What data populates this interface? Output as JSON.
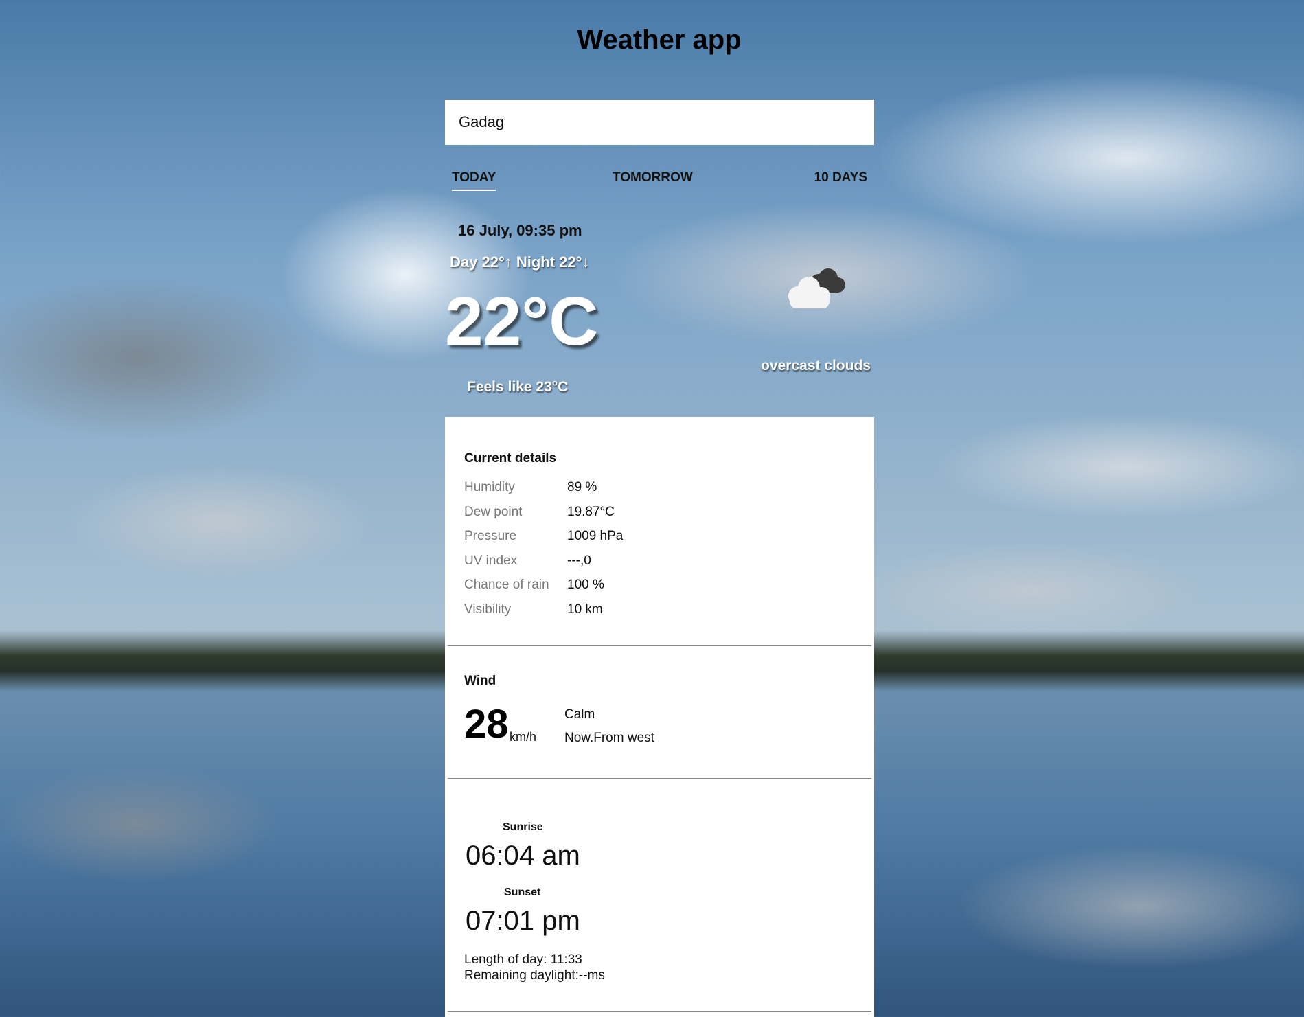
{
  "header": {
    "title": "Weather app"
  },
  "search": {
    "value": "Gadag",
    "placeholder": ""
  },
  "tabs": [
    {
      "label": "TODAY",
      "active": true
    },
    {
      "label": "TOMORROW",
      "active": false
    },
    {
      "label": "10 DAYS",
      "active": false
    }
  ],
  "current": {
    "date": "16 July, 09:35 pm",
    "day_night": "Day 22°↑ Night 22°↓",
    "temperature": "22°C",
    "feels_like": "Feels like 23°C",
    "condition": "overcast clouds",
    "icon": "overcast-cloud-icon"
  },
  "details": {
    "title": "Current details",
    "rows": [
      {
        "label": "Humidity",
        "value": "89 %"
      },
      {
        "label": "Dew point",
        "value": "19.87°C"
      },
      {
        "label": "Pressure",
        "value": "1009 hPa"
      },
      {
        "label": "UV index",
        "value": "---,0"
      },
      {
        "label": "Chance of rain",
        "value": "100 %"
      },
      {
        "label": "Visibility",
        "value": "10 km"
      }
    ]
  },
  "wind": {
    "title": "Wind",
    "speed": "28",
    "unit": "km/h",
    "description": "Calm",
    "direction": "Now.From west"
  },
  "sun": {
    "sunrise_label": "Sunrise",
    "sunrise": "06:04 am",
    "sunset_label": "Sunset",
    "sunset": "07:01 pm",
    "length_of_day": "Length of day: 11:33",
    "remaining_daylight": "Remaining daylight:--ms"
  }
}
